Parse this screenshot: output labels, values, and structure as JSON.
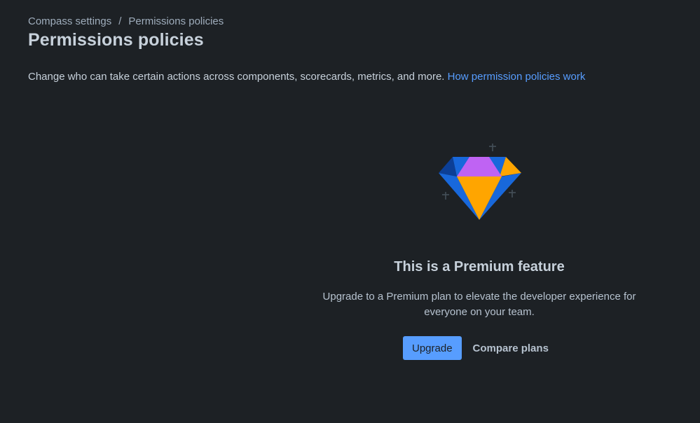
{
  "breadcrumb": {
    "items": [
      "Compass settings",
      "Permissions policies"
    ],
    "separator": "/"
  },
  "page": {
    "title": "Permissions policies",
    "description": "Change who can take certain actions across components, scorecards, metrics, and more.",
    "help_link": "How permission policies work"
  },
  "premium": {
    "illustration_icon": "diamond-icon",
    "title": "This is a Premium feature",
    "description": "Upgrade to a Premium plan to elevate the developer experience for everyone on your team.",
    "upgrade_button": "Upgrade",
    "compare_button": "Compare plans"
  },
  "colors": {
    "background": "#1d2125",
    "link": "#579dff",
    "primary_button": "#579dff",
    "diamond_blue": "#1868db",
    "diamond_orange": "#ffa500",
    "diamond_purple": "#bf63f3"
  }
}
